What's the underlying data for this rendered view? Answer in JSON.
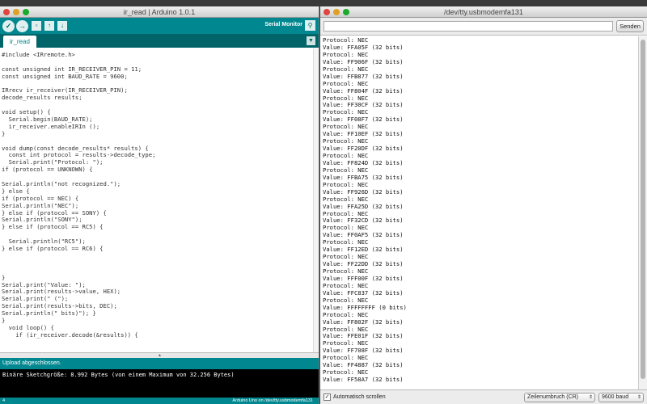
{
  "ide": {
    "title": "ir_read | Arduino 1.0.1",
    "serial_monitor_label": "Serial Monitor",
    "tab_label": "ir_read",
    "code_lines": [
      "#include <IRremote.h>",
      "",
      "const unsigned int IR_RECEIVER_PIN = 11;",
      "const unsigned int BAUD_RATE = 9600;",
      "",
      "IRrecv ir_receiver(IR_RECEIVER_PIN);",
      "decode_results results;",
      "",
      "void setup() {",
      "  Serial.begin(BAUD_RATE);",
      "  ir_receiver.enableIRIn ();",
      "}",
      "",
      "void dump(const decode_results* results) {",
      "  const int protocol = results->decode_type;",
      "  Serial.print(\"Protocol: \");",
      "if (protocol == UNKNOWN) {",
      "",
      "Serial.println(\"not recognized.\");",
      "} else {",
      "if (protocol == NEC) {",
      "Serial.println(\"NEC\");",
      "} else if (protocol == SONY) {",
      "Serial.println(\"SONY\");",
      "} else if (protocol == RC5) {",
      "",
      "  Serial.println(\"RC5\");",
      "} else if (protocol == RC6) {",
      "",
      "",
      "",
      "}",
      "Serial.print(\"Value: \");",
      "Serial.print(results->value, HEX);",
      "Serial.print(\" (\");",
      "Serial.print(results->bits, DEC);",
      "Serial.println(\" bits)\"); }",
      "}",
      "  void loop() {",
      "    if (ir_receiver.decode(&results)) {"
    ],
    "status_text": "Upload abgeschlossen.",
    "console_text": "Binäre Sketchgröße: 8.992 Bytes (von einem Maximum von 32.256 Bytes)",
    "line_number": "4",
    "board_text": "Arduino Uno on /dev/tty.usbmodemfa131"
  },
  "serial": {
    "title": "/dev/tty.usbmodemfa131",
    "send_label": "Senden",
    "output_lines": [
      "Protocol: NEC",
      "Value: FFA05F (32 bits)",
      "Protocol: NEC",
      "Value: FF906F (32 bits)",
      "Protocol: NEC",
      "Value: FFB877 (32 bits)",
      "Protocol: NEC",
      "Value: FF804F (32 bits)",
      "Protocol: NEC",
      "Value: FF30CF (32 bits)",
      "Protocol: NEC",
      "Value: FF08F7 (32 bits)",
      "Protocol: NEC",
      "Value: FF10EF (32 bits)",
      "Protocol: NEC",
      "Value: FF20DF (32 bits)",
      "Protocol: NEC",
      "Value: FF824D (32 bits)",
      "Protocol: NEC",
      "Value: FFBA75 (32 bits)",
      "Protocol: NEC",
      "Value: FF926D (32 bits)",
      "Protocol: NEC",
      "Value: FFA25D (32 bits)",
      "Protocol: NEC",
      "Value: FF32CD (32 bits)",
      "Protocol: NEC",
      "Value: FF0AF5 (32 bits)",
      "Protocol: NEC",
      "Value: FF12ED (32 bits)",
      "Protocol: NEC",
      "Value: FF22DD (32 bits)",
      "Protocol: NEC",
      "Value: FFF00F (32 bits)",
      "Protocol: NEC",
      "Value: FFC837 (32 bits)",
      "Protocol: NEC",
      "Value: FFFFFFFF (0 bits)",
      "Protocol: NEC",
      "Value: FF802F (32 bits)",
      "Protocol: NEC",
      "Value: FFE01F (32 bits)",
      "Protocol: NEC",
      "Value: FF708F (32 bits)",
      "Protocol: NEC",
      "Value: FF4887 (32 bits)",
      "Protocol: NEC",
      "Value: FF58A7 (32 bits)"
    ],
    "autoscroll_label": "Automatisch scrollen",
    "autoscroll_checked": true,
    "line_ending_value": "Zeilenumbruch (CR)",
    "baud_value": "9600 baud"
  }
}
